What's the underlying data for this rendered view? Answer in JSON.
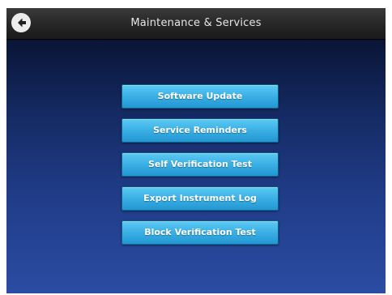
{
  "header": {
    "title": "Maintenance & Services",
    "back_icon": "back-arrow-circle-icon"
  },
  "menu": {
    "items": [
      {
        "label": "Software Update"
      },
      {
        "label": "Service Reminders"
      },
      {
        "label": "Self Verification Test"
      },
      {
        "label": "Export Instrument Log"
      },
      {
        "label": "Block Verification Test"
      }
    ]
  },
  "colors": {
    "button_top": "#5cc9f2",
    "button_bottom": "#2196d2",
    "background_top": "#040712",
    "background_bottom": "#2b4ca3",
    "title_bar": "#262626"
  }
}
